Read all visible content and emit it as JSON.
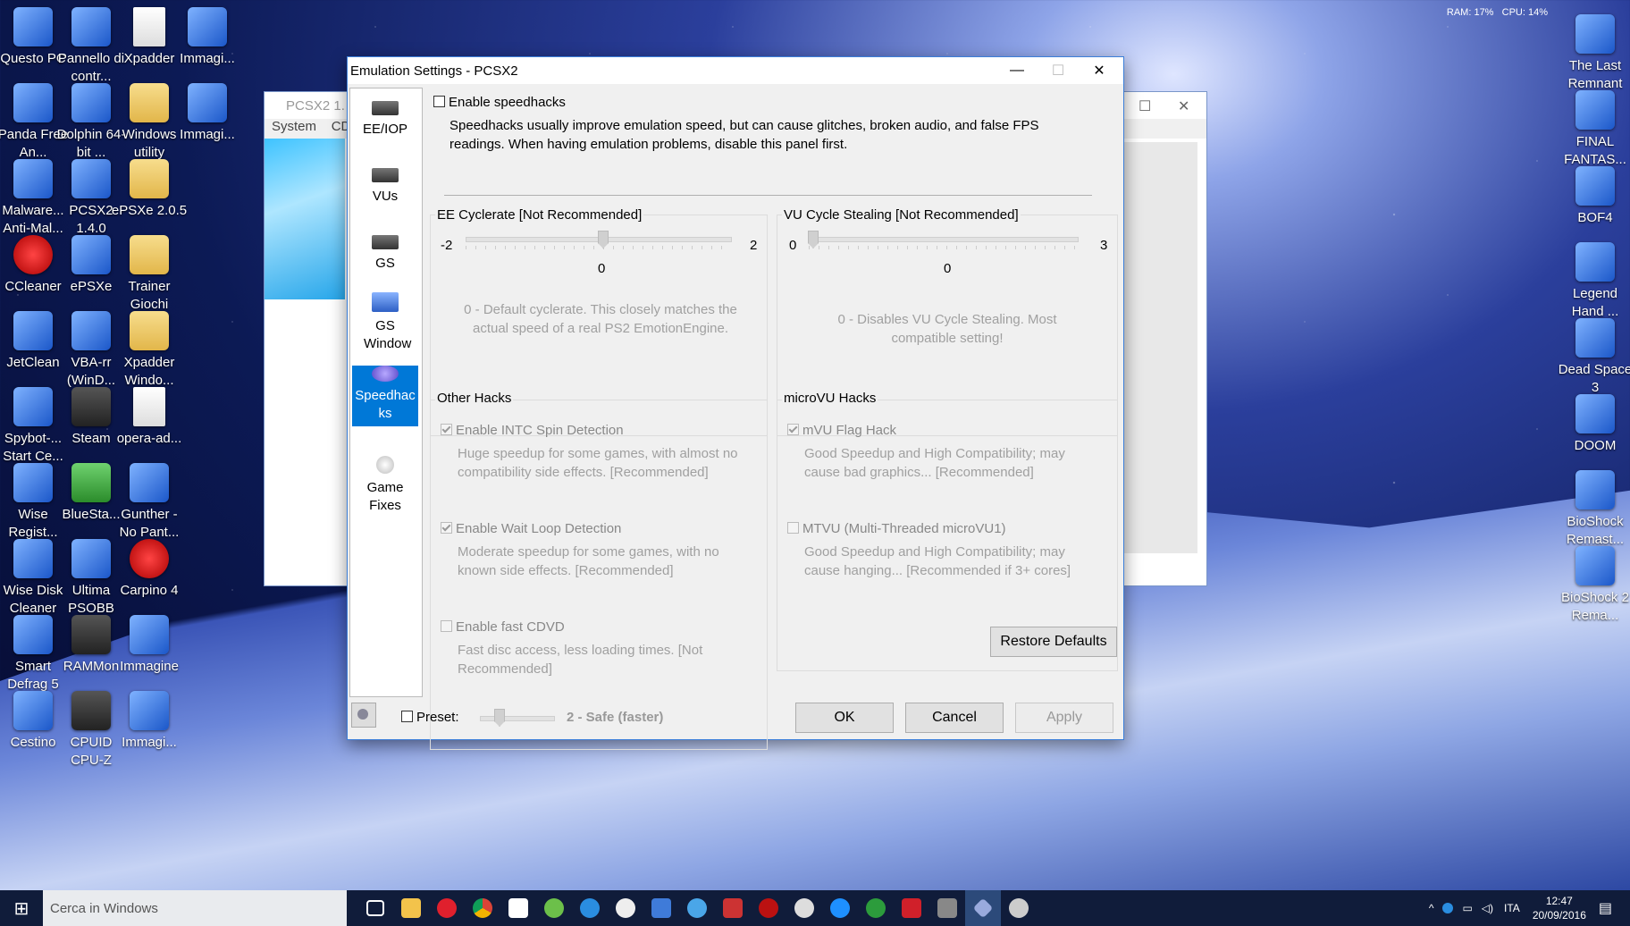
{
  "desktop": {
    "left_icons": [
      {
        "label": "Questo PC",
        "col": 0,
        "row": 0
      },
      {
        "label": "Pannello di contr...",
        "col": 1,
        "row": 0
      },
      {
        "label": "Xpadder",
        "col": 2,
        "row": 0
      },
      {
        "label": "Immagi...",
        "col": 3,
        "row": 0
      },
      {
        "label": "Panda Free An...",
        "col": 0,
        "row": 1
      },
      {
        "label": "Dolphin 64-bit ...",
        "col": 1,
        "row": 1
      },
      {
        "label": "Windows utility",
        "col": 2,
        "row": 1
      },
      {
        "label": "Immagi...",
        "col": 3,
        "row": 1
      },
      {
        "label": "Malware... Anti-Mal...",
        "col": 0,
        "row": 2
      },
      {
        "label": "PCSX2 1.4.0",
        "col": 1,
        "row": 2
      },
      {
        "label": "ePSXe 2.0.5",
        "col": 2,
        "row": 2
      },
      {
        "label": "CCleaner",
        "col": 0,
        "row": 3
      },
      {
        "label": "ePSXe",
        "col": 1,
        "row": 3
      },
      {
        "label": "Trainer Giochi",
        "col": 2,
        "row": 3
      },
      {
        "label": "JetClean",
        "col": 0,
        "row": 4
      },
      {
        "label": "VBA-rr (WinD...",
        "col": 1,
        "row": 4
      },
      {
        "label": "Xpadder Windo...",
        "col": 2,
        "row": 4
      },
      {
        "label": "Spybot-... Start Ce...",
        "col": 0,
        "row": 5
      },
      {
        "label": "Steam",
        "col": 1,
        "row": 5
      },
      {
        "label": "opera-ad...",
        "col": 2,
        "row": 5
      },
      {
        "label": "Wise Regist...",
        "col": 0,
        "row": 6
      },
      {
        "label": "BlueSta...",
        "col": 1,
        "row": 6
      },
      {
        "label": "Gunther - No Pant...",
        "col": 2,
        "row": 6
      },
      {
        "label": "Wise Disk Cleaner",
        "col": 0,
        "row": 7
      },
      {
        "label": "Ultima PSOBB",
        "col": 1,
        "row": 7
      },
      {
        "label": "Carpino 4",
        "col": 2,
        "row": 7
      },
      {
        "label": "Smart Defrag 5",
        "col": 0,
        "row": 8
      },
      {
        "label": "RAMMon",
        "col": 1,
        "row": 8
      },
      {
        "label": "Immagine",
        "col": 2,
        "row": 8
      },
      {
        "label": "Cestino",
        "col": 0,
        "row": 9
      },
      {
        "label": "CPUID CPU-Z",
        "col": 1,
        "row": 9
      },
      {
        "label": "Immagi...",
        "col": 2,
        "row": 9
      }
    ],
    "right_icons": [
      {
        "label": "The Last Remnant",
        "row": 0
      },
      {
        "label": "FINAL FANTAS...",
        "row": 1
      },
      {
        "label": "BOF4",
        "row": 2
      },
      {
        "label": "Legend Hand ...",
        "row": 3
      },
      {
        "label": "Dead Space 3",
        "row": 4
      },
      {
        "label": "DOOM",
        "row": 5
      },
      {
        "label": "BioShock Remast...",
        "row": 6
      },
      {
        "label": "BioShock 2 Rema...",
        "row": 7
      }
    ],
    "monitor": {
      "ram": "RAM: 17%",
      "cpu": "CPU: 14%"
    }
  },
  "bg_window": {
    "title": "PCSX2  1.",
    "menu_system": "System",
    "menu_cd": "CD"
  },
  "dialog": {
    "title": "Emulation Settings - PCSX2",
    "sidebar": [
      "EE/IOP",
      "VUs",
      "GS",
      "GS Window",
      "Speedhac ks",
      "Game Fixes"
    ],
    "enable_speedhacks": "Enable speedhacks",
    "speedhacks_desc": "Speedhacks usually improve emulation speed, but can cause glitches, broken audio, and false FPS readings.  When having emulation problems, disable this panel first.",
    "ee_cyclerate": {
      "label": "EE Cyclerate [Not Recommended]",
      "min": "-2",
      "max": "2",
      "value": "0",
      "desc": "0 - Default cyclerate. This closely matches the actual speed of a real PS2 EmotionEngine."
    },
    "vu_cycle": {
      "label": "VU Cycle Stealing [Not Recommended]",
      "min": "0",
      "max": "3",
      "value": "0",
      "desc": "0 - Disables VU Cycle Stealing.  Most compatible setting!"
    },
    "other_hacks": {
      "label": "Other Hacks",
      "intc": "Enable INTC Spin Detection",
      "intc_desc": "Huge speedup for some games, with almost no compatibility side effects. [Recommended]",
      "wait": "Enable Wait Loop Detection",
      "wait_desc": "Moderate speedup for some games, with no known side effects. [Recommended]",
      "cdvd": "Enable fast CDVD",
      "cdvd_desc": "Fast disc access, less loading times. [Not Recommended]"
    },
    "microvu_hacks": {
      "label": "microVU Hacks",
      "flag": "mVU Flag Hack",
      "flag_desc": "Good Speedup and High Compatibility; may cause bad graphics... [Recommended]",
      "mtvu": "MTVU (Multi-Threaded microVU1)",
      "mtvu_desc": "Good Speedup and High Compatibility; may cause hanging... [Recommended if 3+ cores]"
    },
    "restore": "Restore Defaults",
    "preset": "Preset:",
    "preset_value": "2 - Safe (faster)",
    "ok": "OK",
    "cancel": "Cancel",
    "apply": "Apply"
  },
  "taskbar": {
    "search": "Cerca in Windows",
    "lang": "ITA",
    "time": "12:47",
    "date": "20/09/2016"
  }
}
